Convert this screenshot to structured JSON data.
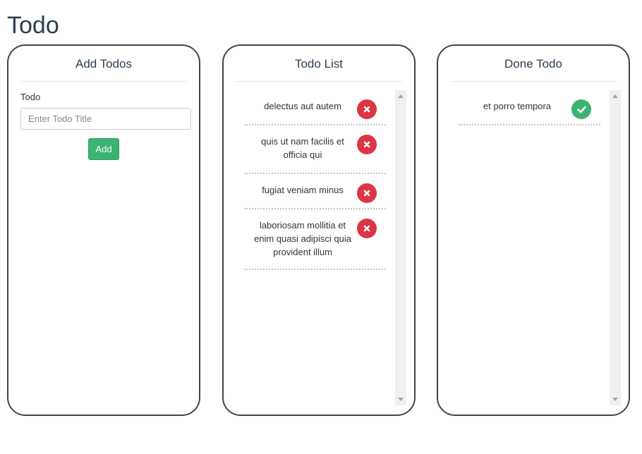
{
  "page": {
    "title": "Todo"
  },
  "add_panel": {
    "header": "Add Todos",
    "field_label": "Todo",
    "input_placeholder": "Enter Todo Title",
    "input_value": "",
    "add_button": "Add"
  },
  "list_panel": {
    "header": "Todo List",
    "items": [
      {
        "text": "delectus aut autem",
        "action_icon": "delete-x-icon"
      },
      {
        "text": "quis ut nam facilis et officia qui",
        "action_icon": "delete-x-icon"
      },
      {
        "text": "fugiat veniam minus",
        "action_icon": "delete-x-icon"
      },
      {
        "text": "laboriosam mollitia et enim quasi adipisci quia provident illum",
        "action_icon": "delete-x-icon"
      }
    ]
  },
  "done_panel": {
    "header": "Done Todo",
    "items": [
      {
        "text": "et porro tempora",
        "action_icon": "check-icon"
      }
    ]
  },
  "colors": {
    "text": "#2c3e50",
    "panel_border": "#444444",
    "delete": "#dc3545",
    "done": "#3cb371",
    "add_button": "#3cb371",
    "scrollbar_track": "#f0f0f0"
  }
}
